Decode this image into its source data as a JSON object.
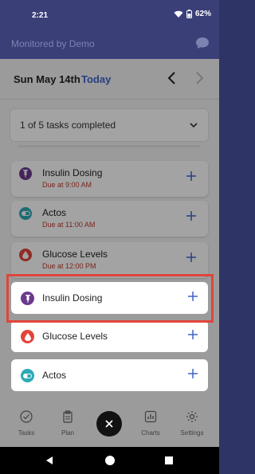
{
  "status": {
    "time": "2:21",
    "battery": "62%"
  },
  "app_bar": {
    "title": "Monitored by Demo"
  },
  "date_nav": {
    "date": "Sun May 14th",
    "today": "Today"
  },
  "progress": {
    "text": "1 of 5 tasks completed",
    "fraction": 0.2
  },
  "tasks": [
    {
      "name": "Insulin Dosing",
      "due": "Due at 9:00 AM",
      "icon": "syringe-icon",
      "color": "#6a3a8e"
    },
    {
      "name": "Actos",
      "due": "Due at 11:00 AM",
      "icon": "pill-icon",
      "color": "#2eaab5"
    },
    {
      "name": "Glucose Levels",
      "due": "Due at 12:00 PM",
      "icon": "drop-icon",
      "color": "#e0453b"
    }
  ],
  "options": [
    {
      "name": "Insulin Dosing",
      "icon": "syringe-icon",
      "color": "#6a3a8e"
    },
    {
      "name": "Glucose Levels",
      "icon": "drop-icon",
      "color": "#e0453b"
    },
    {
      "name": "Actos",
      "icon": "pill-icon",
      "color": "#2eaab5"
    }
  ],
  "bottom_nav": [
    {
      "label": "Tasks",
      "icon": "check-circle-icon"
    },
    {
      "label": "Plan",
      "icon": "clipboard-icon"
    },
    {
      "label": "Charts",
      "icon": "chart-icon"
    },
    {
      "label": "Settings",
      "icon": "gear-icon"
    }
  ],
  "colors": {
    "accent": "#3f63c6",
    "highlight": "#e0453b",
    "header": "#3a3f78"
  }
}
